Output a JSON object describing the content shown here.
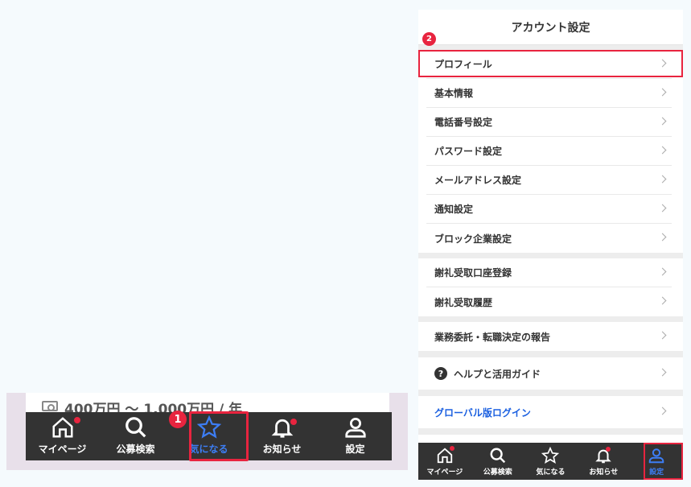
{
  "left": {
    "salary_text": "400万円 〜 1,000万円 / 年",
    "step_badge": "1",
    "nav": [
      {
        "label": "マイページ",
        "icon": "home-icon",
        "dot": true
      },
      {
        "label": "公募検索",
        "icon": "search-icon",
        "dot": false
      },
      {
        "label": "気になる",
        "icon": "star-icon",
        "dot": false,
        "active": true
      },
      {
        "label": "お知らせ",
        "icon": "bell-icon",
        "dot": true
      },
      {
        "label": "設定",
        "icon": "user-icon",
        "dot": false
      }
    ]
  },
  "right": {
    "title": "アカウント設定",
    "step_badge": "2",
    "group1": [
      "プロフィール",
      "基本情報",
      "電話番号設定",
      "パスワード設定",
      "メールアドレス設定",
      "通知設定",
      "ブロック企業設定"
    ],
    "group2": [
      "謝礼受取口座登録",
      "謝礼受取履歴"
    ],
    "group3": [
      "業務委託・転職決定の報告"
    ],
    "help_label": "ヘルプと活用ガイド",
    "global_login": "グローバル版ログイン",
    "nav": [
      {
        "label": "マイページ",
        "icon": "home-icon",
        "dot": true
      },
      {
        "label": "公募検索",
        "icon": "search-icon",
        "dot": false
      },
      {
        "label": "気になる",
        "icon": "star-icon",
        "dot": false
      },
      {
        "label": "お知らせ",
        "icon": "bell-icon",
        "dot": true
      },
      {
        "label": "設定",
        "icon": "user-icon",
        "dot": false,
        "active": true
      }
    ]
  },
  "colors": {
    "accent": "#3d7ef5",
    "highlight": "#e8243f",
    "nav_bg": "#333333",
    "link": "#1a5fe0"
  }
}
